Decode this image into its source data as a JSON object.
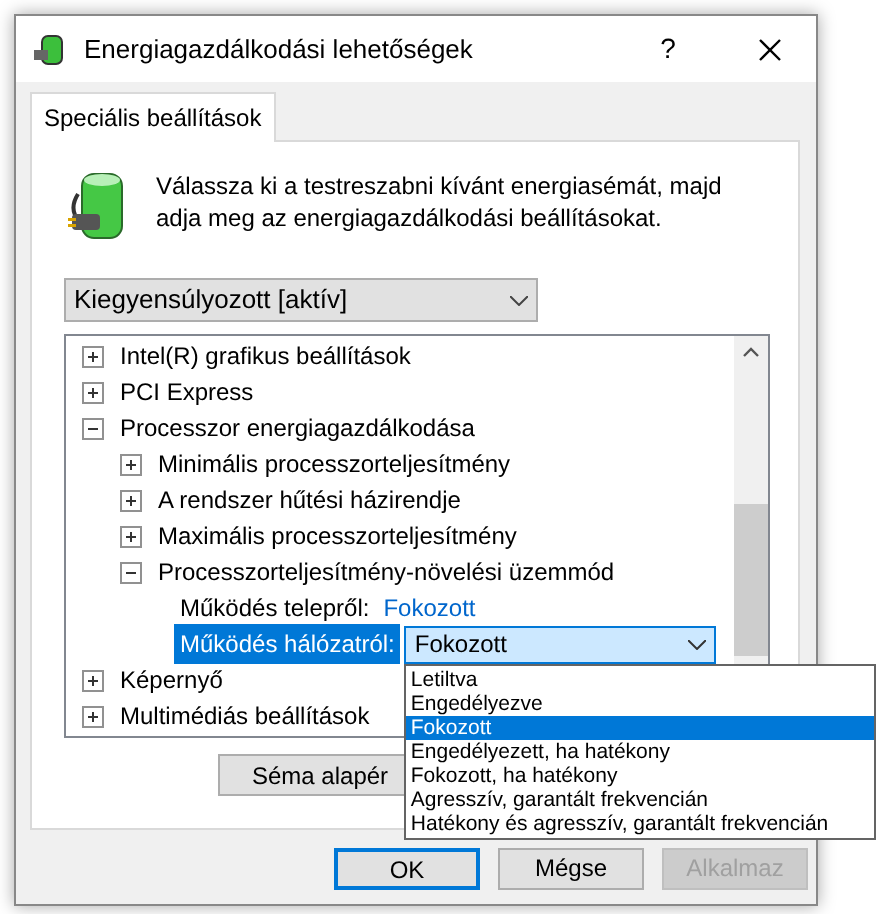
{
  "window": {
    "title": "Energiagazdálkodási lehetőségek",
    "help": "?"
  },
  "tabs": [
    {
      "label": "Speciális beállítások",
      "selected": true
    }
  ],
  "description": "Válassza ki a testreszabni kívánt energiasémát, majd adja meg az energiagazdálkodási beállításokat.",
  "scheme_select": {
    "value": "Kiegyensúlyozott [aktív]"
  },
  "tree": [
    {
      "kind": "group",
      "label": "Intel(R) grafikus beállítások",
      "expanded": false
    },
    {
      "kind": "group",
      "label": "PCI Express",
      "expanded": false
    },
    {
      "kind": "group",
      "label": "Processzor energiagazdálkodása",
      "expanded": true,
      "children": [
        {
          "kind": "group",
          "label": "Minimális processzorteljesítmény",
          "expanded": false
        },
        {
          "kind": "group",
          "label": "A rendszer hűtési házirendje",
          "expanded": false
        },
        {
          "kind": "group",
          "label": "Maximális processzorteljesítmény",
          "expanded": false
        },
        {
          "kind": "group",
          "label": "Processzorteljesítmény-növelési üzemmód",
          "expanded": true,
          "children": [
            {
              "kind": "value",
              "label": "Működés telepről:",
              "value": "Fokozott",
              "selected": false
            },
            {
              "kind": "select",
              "label": "Működés hálózatról:",
              "value": "Fokozott",
              "selected": true
            }
          ]
        }
      ]
    },
    {
      "kind": "group",
      "label": "Képernyő",
      "expanded": false
    },
    {
      "kind": "group",
      "label": "Multimédiás beállítások",
      "expanded": false
    }
  ],
  "restore_button": "Séma alapér",
  "dropdown_options": [
    {
      "label": "Letiltva",
      "selected": false
    },
    {
      "label": "Engedélyezve",
      "selected": false
    },
    {
      "label": "Fokozott",
      "selected": true
    },
    {
      "label": "Engedélyezett, ha hatékony",
      "selected": false
    },
    {
      "label": "Fokozott, ha hatékony",
      "selected": false
    },
    {
      "label": "Agresszív, garantált frekvencián",
      "selected": false
    },
    {
      "label": "Hatékony és agresszív, garantált frekvencián",
      "selected": false
    }
  ],
  "buttons": [
    {
      "label": "OK",
      "default": true,
      "disabled": false
    },
    {
      "label": "Mégse",
      "default": false,
      "disabled": false
    },
    {
      "label": "Alkalmaz",
      "default": false,
      "disabled": true
    }
  ]
}
